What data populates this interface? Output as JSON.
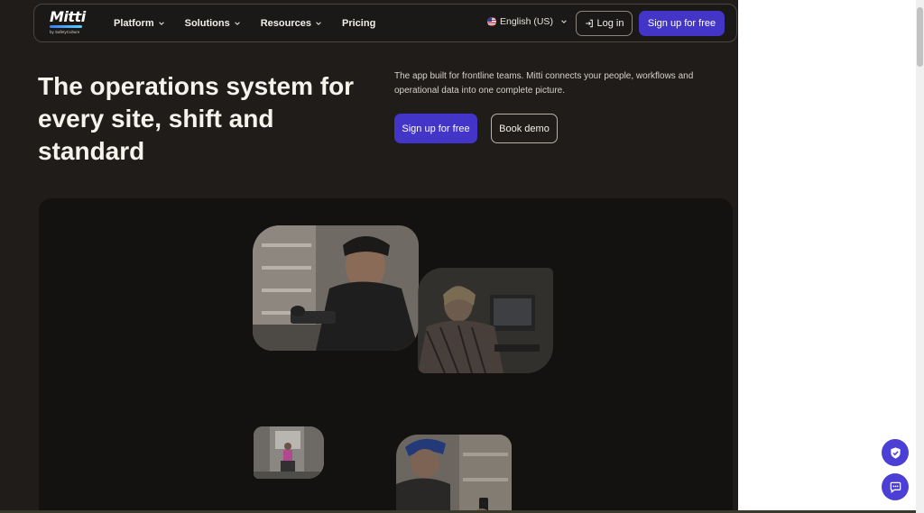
{
  "brand": {
    "name": "Mitti",
    "tagline": "by SafetyCulture"
  },
  "nav": {
    "items": [
      {
        "label": "Platform",
        "has_dropdown": true
      },
      {
        "label": "Solutions",
        "has_dropdown": true
      },
      {
        "label": "Resources",
        "has_dropdown": true
      },
      {
        "label": "Pricing",
        "has_dropdown": false
      }
    ],
    "language": "English (US)",
    "login_label": "Log in",
    "signup_label": "Sign up for free"
  },
  "hero": {
    "title": "The operations system for every site, shift and standard",
    "description": "The app built for frontline teams. Mitti connects your people, workflows and operational data into one complete picture.",
    "primary_cta": "Sign up for free",
    "secondary_cta": "Book demo"
  },
  "colors": {
    "background": "#1f1c1a",
    "accent": "#4335c8",
    "panel": "#141211",
    "fab": "#4b3fd6"
  },
  "icons": {
    "login": "login-arrow-icon",
    "language": "us-flag-icon",
    "dropdown": "chevron-down-icon",
    "privacy": "shield-check-icon",
    "chat": "chat-bubble-icon"
  }
}
